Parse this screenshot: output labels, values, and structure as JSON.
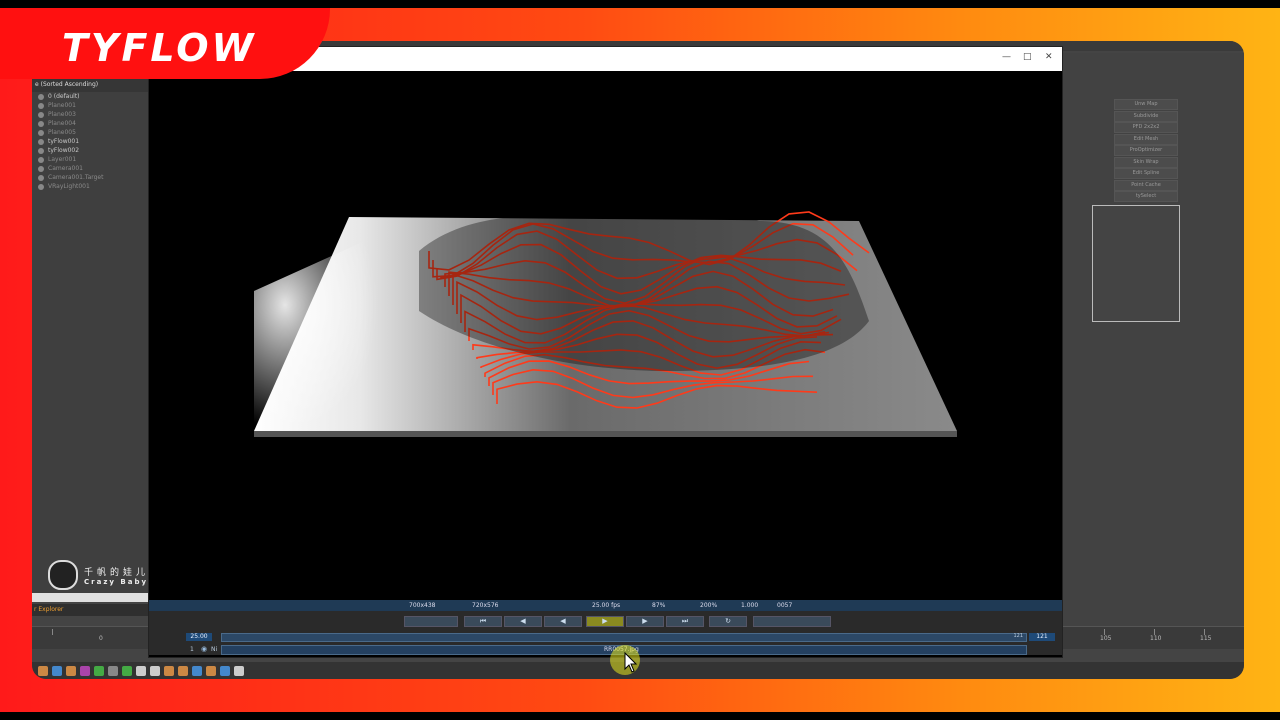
{
  "brand": {
    "title": "TYFLOW"
  },
  "explorer": {
    "header": "e (Sorted Ascending)",
    "rows": [
      {
        "label": "0 (default)",
        "dim": false
      },
      {
        "label": "Plane001",
        "dim": true
      },
      {
        "label": "Plane003",
        "dim": true
      },
      {
        "label": "Plane004",
        "dim": true
      },
      {
        "label": "Plane005",
        "dim": true
      },
      {
        "label": "tyFlow001",
        "dim": false
      },
      {
        "label": "tyFlow002",
        "dim": false
      },
      {
        "label": "Layer001",
        "dim": true
      },
      {
        "label": "Camera001",
        "dim": true
      },
      {
        "label": "Camera001.Target",
        "dim": true
      },
      {
        "label": "VRayLight001",
        "dim": true
      }
    ],
    "footer": "r Explorer"
  },
  "watermark": {
    "chinese": "千帆的娃儿",
    "english": "Crazy Baby"
  },
  "command_panel": {
    "buttons": [
      "Unw Map",
      "Subdivide",
      "PFD 2x2x2",
      "Edit Mesh",
      "ProOptimizer",
      "Skin Wrap",
      "Edit Spline",
      "Point Cache",
      "tySelect"
    ]
  },
  "vfb": {
    "status": {
      "image_size": "700x438",
      "resolution": "720x576",
      "fps": "25.00 fps",
      "zoom1": "87%",
      "zoom2": "200%",
      "gamma": "1.000",
      "frame": "0057"
    },
    "controls": {
      "speed": "25.00",
      "end_frame": "121",
      "slider_end": "121"
    },
    "history": {
      "index": "1",
      "label": "Ni",
      "file": "RR0057.jpg"
    }
  },
  "timeline": {
    "ticks": [
      "0",
      "105",
      "110",
      "115"
    ]
  },
  "colors": {
    "accent_red": "#ff1010",
    "render_wire": "#ff3a1a",
    "vfb_status_bg": "#1f3a55"
  }
}
